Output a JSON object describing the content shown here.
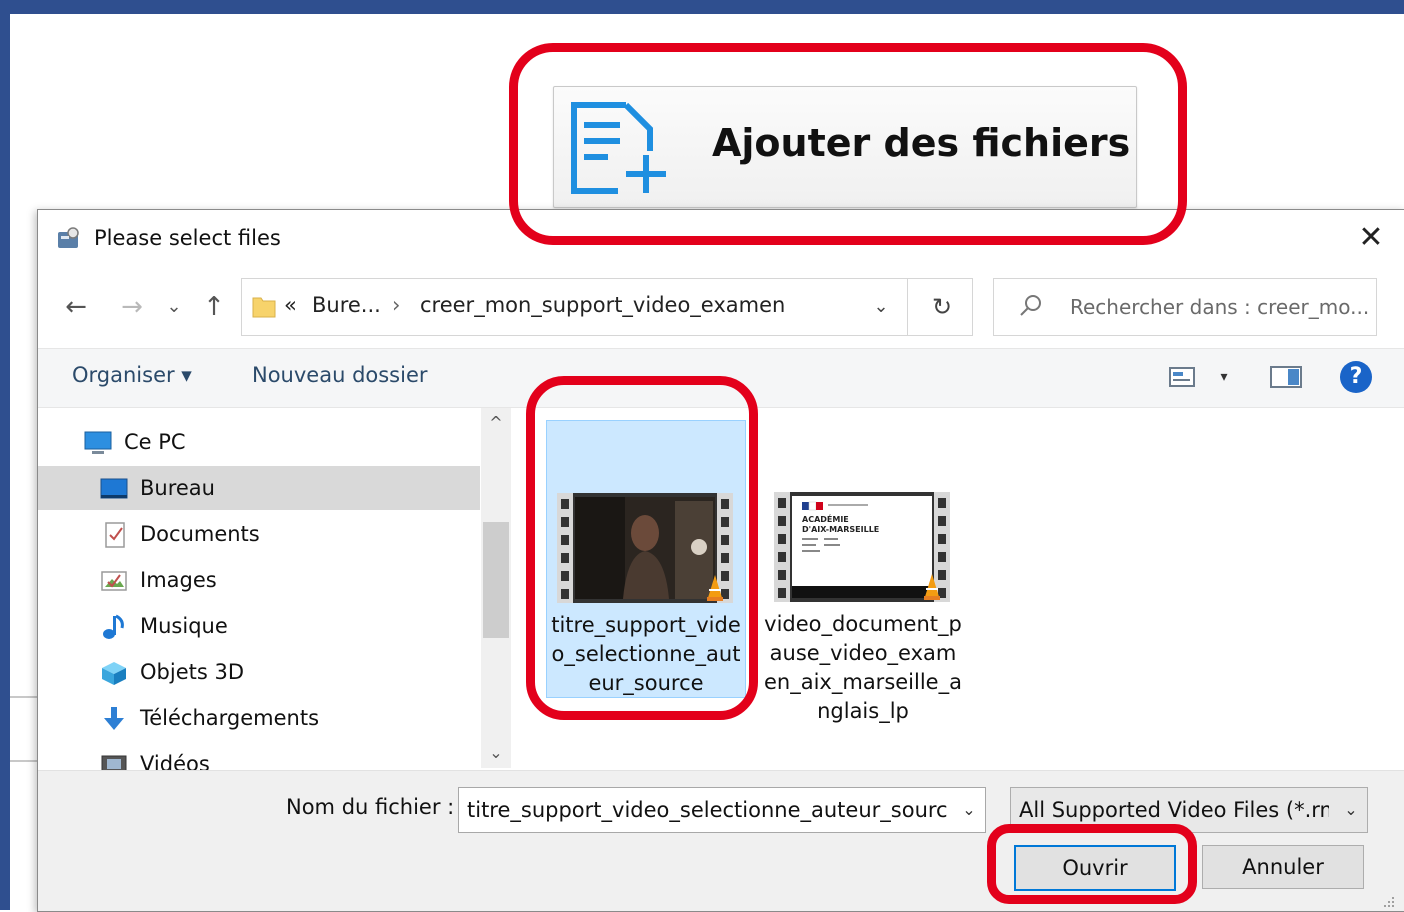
{
  "add_button": {
    "label": "Ajouter des fichiers",
    "icon": "add-file-icon"
  },
  "dialog": {
    "title": "Please select files",
    "close_symbol": "✕",
    "nav": {
      "back": "←",
      "forward": "→",
      "recent": "⌄",
      "up": "↑"
    },
    "address": {
      "overflow": "«",
      "crumbs": [
        "Bure...",
        "creer_mon_support_video_examen"
      ],
      "separator": "›",
      "dropdown": "⌄",
      "refresh": "↻"
    },
    "search": {
      "placeholder": "Rechercher dans : creer_mo..."
    },
    "toolbar": {
      "organiser": "Organiser ▾",
      "new_folder": "Nouveau dossier",
      "help": "?",
      "view_arrow": "▾"
    },
    "tree": [
      {
        "label": "Ce PC",
        "icon": "computer-icon"
      },
      {
        "label": "Bureau",
        "icon": "desktop-icon",
        "selected": true
      },
      {
        "label": "Documents",
        "icon": "documents-icon"
      },
      {
        "label": "Images",
        "icon": "images-icon"
      },
      {
        "label": "Musique",
        "icon": "music-icon"
      },
      {
        "label": "Objets 3D",
        "icon": "objects-3d-icon"
      },
      {
        "label": "Téléchargements",
        "icon": "downloads-icon"
      },
      {
        "label": "Vidéos",
        "icon": "videos-icon"
      }
    ],
    "scroll": {
      "up": "^",
      "down": "⌄"
    },
    "files": [
      {
        "name": "titre_support_video_selectionne_auteur_source",
        "selected": true,
        "thumb": "video-thumbnail"
      },
      {
        "name": "video_document_pause_video_examen_aix_marseille_anglais_lp",
        "selected": false,
        "thumb": "video-thumbnail",
        "thumb_text": [
          "ACADÉMIE",
          "D'AIX-MARSEILLE"
        ]
      }
    ],
    "filename_label": "Nom du fichier :",
    "filename_value": "titre_support_video_selectionne_auteur_source",
    "filter_value": "All Supported Video Files (*.rm",
    "dropdown_arrow": "⌄",
    "open_label": "Ouvrir",
    "cancel_label": "Annuler"
  },
  "colors": {
    "accent": "#0078d7",
    "annotation_red": "#e3001b",
    "selection": "#cce8ff",
    "frame_blue": "#2f4f8f"
  }
}
